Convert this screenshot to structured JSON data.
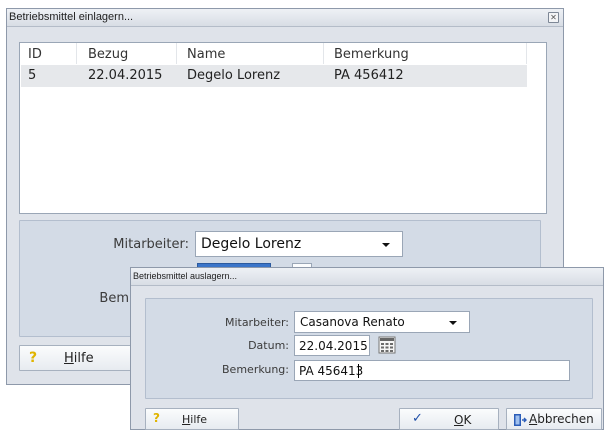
{
  "back_window": {
    "title": "Betriebsmittel einlagern...",
    "close_glyph": "✕",
    "table": {
      "columns": [
        "ID",
        "Bezug",
        "Name",
        "Bemerkung"
      ],
      "rows": [
        [
          "5",
          "22.04.2015",
          "Degelo Lorenz",
          "PA 456412"
        ]
      ]
    },
    "mitarbeiter_label": "Mitarbeiter:",
    "mitarbeiter_value": "Degelo Lorenz",
    "bemerkung_label_partial": "Bem",
    "help_icon": "?",
    "help_label_first": "H",
    "help_label_rest": "ilfe"
  },
  "front_window": {
    "title": "Betriebsmittel auslagern...",
    "mitarbeiter_label": "Mitarbeiter:",
    "mitarbeiter_value": "Casanova Renato",
    "datum_label": "Datum:",
    "datum_value": "22.04.2015",
    "bemerkung_label": "Bemerkung:",
    "bemerkung_value": "PA 456413",
    "help_icon": "?",
    "help_label_first": "H",
    "help_label_rest": "ilfe",
    "ok_icon": "✓",
    "ok_label_first": "O",
    "ok_label_rest": "K",
    "cancel_label_first": "A",
    "cancel_label_rest": "bbrechen"
  },
  "colors": {
    "help_icon": "#e0b400",
    "ok_icon": "#1f4fa8",
    "cancel_icon": "#2b5db8"
  }
}
